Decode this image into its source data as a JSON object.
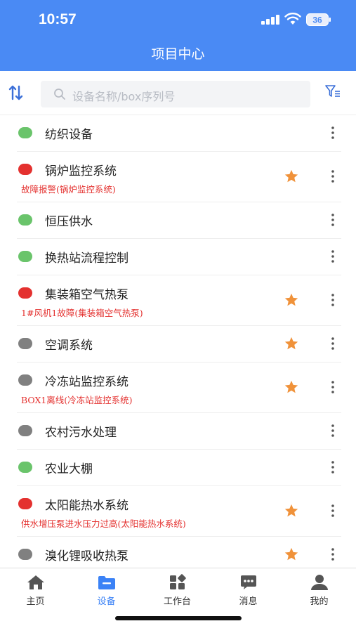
{
  "status_bar": {
    "time": "10:57",
    "battery": "36"
  },
  "header": {
    "title": "项目中心"
  },
  "search": {
    "placeholder": "设备名称/box序列号"
  },
  "devices": [
    {
      "name": "纺织设备",
      "status": "green",
      "starred": false
    },
    {
      "name": "锅炉监控系统",
      "status": "red",
      "alarm": "故障报警(锅炉监控系统)",
      "starred": true
    },
    {
      "name": "恒压供水",
      "status": "green",
      "starred": false
    },
    {
      "name": "换热站流程控制",
      "status": "green",
      "starred": false
    },
    {
      "name": "集装箱空气热泵",
      "status": "red",
      "alarm": "1#风机1故障(集装箱空气热泵)",
      "starred": true
    },
    {
      "name": "空调系统",
      "status": "gray",
      "starred": true
    },
    {
      "name": "冷冻站监控系统",
      "status": "gray",
      "alarm": "BOX1离线(冷冻站监控系统)",
      "starred": true
    },
    {
      "name": "农村污水处理",
      "status": "gray",
      "starred": false
    },
    {
      "name": "农业大棚",
      "status": "green",
      "starred": false
    },
    {
      "name": "太阳能热水系统",
      "status": "red",
      "alarm": "供水增压泵进水压力过高(太阳能热水系统)",
      "starred": true
    },
    {
      "name": "溴化锂吸收热泵",
      "status": "gray",
      "starred": true
    }
  ],
  "tabs": [
    {
      "label": "主页",
      "icon": "home-icon",
      "active": false
    },
    {
      "label": "设备",
      "icon": "device-folder-icon",
      "active": true
    },
    {
      "label": "工作台",
      "icon": "workbench-icon",
      "active": false
    },
    {
      "label": "消息",
      "icon": "message-icon",
      "active": false
    },
    {
      "label": "我的",
      "icon": "profile-icon",
      "active": false
    }
  ],
  "colors": {
    "primary": "#4a8af4",
    "active_tab": "#3b82f6",
    "status_green": "#6ac46b",
    "status_red": "#e4312f",
    "status_gray": "#808080",
    "star": "#f0923a"
  }
}
